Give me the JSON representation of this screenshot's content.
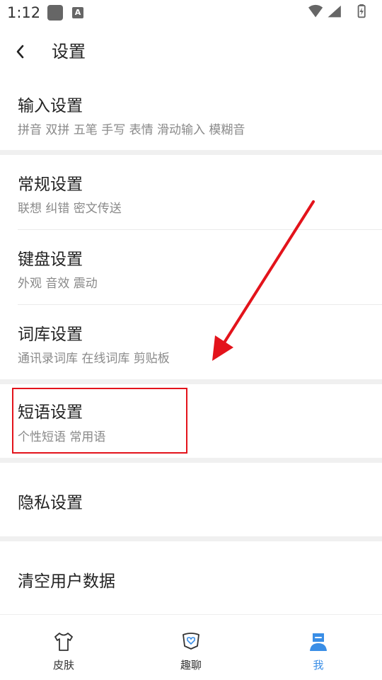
{
  "status_bar": {
    "time": "1:12"
  },
  "header": {
    "title": "设置"
  },
  "settings": [
    {
      "title": "输入设置",
      "subtitle": "拼音 双拼 五笔 手写 表情 滑动输入 模糊音"
    },
    {
      "title": "常规设置",
      "subtitle": "联想 纠错 密文传送"
    },
    {
      "title": "键盘设置",
      "subtitle": "外观 音效 震动"
    },
    {
      "title": "词库设置",
      "subtitle": "通讯录词库 在线词库 剪贴板"
    },
    {
      "title": "短语设置",
      "subtitle": "个性短语 常用语"
    },
    {
      "title": "隐私设置"
    },
    {
      "title": "清空用户数据"
    }
  ],
  "bottom_nav": [
    {
      "label": "皮肤",
      "icon": "shirt-icon",
      "active": false
    },
    {
      "label": "趣聊",
      "icon": "chat-heart-icon",
      "active": false
    },
    {
      "label": "我",
      "icon": "person-icon",
      "active": true
    }
  ],
  "annotation": {
    "arrow_color": "#e3131b",
    "box_color": "#e3131b"
  },
  "colors": {
    "accent": "#3a8ee6",
    "text": "#222222",
    "subtext": "#8a8a8a",
    "divider": "#f0f0f0"
  }
}
